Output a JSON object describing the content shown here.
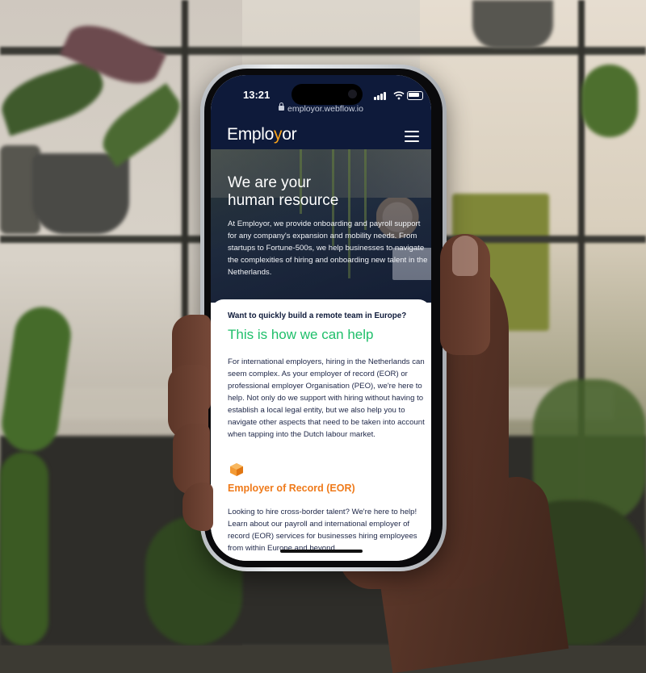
{
  "status_bar": {
    "time": "13:21"
  },
  "browser": {
    "url": "employor.webflow.io"
  },
  "header": {
    "logo_prefix": "Emplo",
    "logo_accent": "y",
    "logo_suffix": "or",
    "menu_icon": "hamburger-menu-icon"
  },
  "hero": {
    "title_line1": "We are your",
    "title_line2": "human resource",
    "text": "At Employor, we provide onboarding and payroll support for any company's expansion and mobility needs. From startups to Fortune-500s, we help businesses to navigate the complexities of hiring and onboarding new talent in the Netherlands."
  },
  "intro": {
    "question": "Want to quickly build a remote team in Europe?",
    "heading": "This is how we can help",
    "body": "For international employers, hiring in the Netherlands can seem complex. As your employer of record (EOR) or professional employer Organisation (PEO), we're here to help. Not only do we support with hiring without having to establish a local legal entity, but we also help you to navigate other aspects that need to be taken into account when tapping into the Dutch labour market."
  },
  "service": {
    "icon": "box-icon",
    "title": "Employer of Record (EOR)",
    "body": "Looking to hire cross-border talent? We're here to help! Learn about our payroll and international employer of record (EOR) services for businesses hiring employees from within Europe and beyond."
  },
  "colors": {
    "nav_bg": "#0e1a3a",
    "accent_green": "#1fbf6a",
    "accent_orange": "#ef7a1a",
    "logo_accent": "#f7a21b"
  }
}
